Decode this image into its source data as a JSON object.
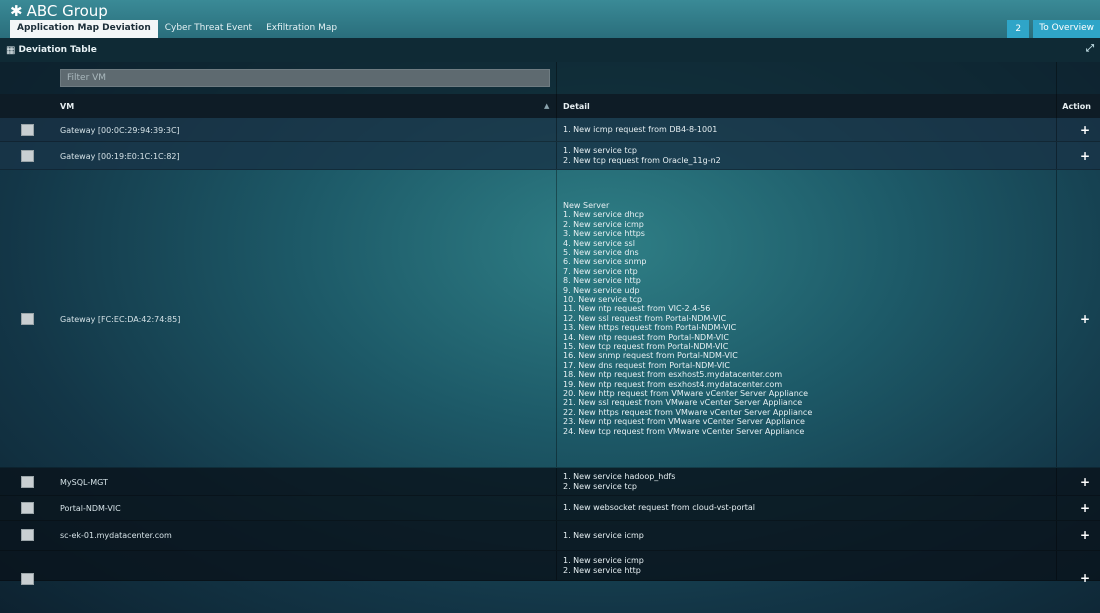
{
  "app": {
    "title": "ABC Group"
  },
  "tabs": [
    {
      "label": "Application Map Deviation",
      "active": true
    },
    {
      "label": "Cyber Threat Event",
      "active": false
    },
    {
      "label": "Exfiltration Map",
      "active": false
    }
  ],
  "controls": {
    "count": "2",
    "overview_label": "To Overview"
  },
  "section": {
    "title": "Deviation Table"
  },
  "filter": {
    "placeholder": "Filter VM"
  },
  "table": {
    "headers": {
      "vm": "VM",
      "detail": "Detail",
      "action": "Action"
    },
    "rows": [
      {
        "vm": "Gateway [00:0C:29:94:39:3C]",
        "detail": [
          "1. New icmp request from DB4-8-1001"
        ]
      },
      {
        "vm": "Gateway [00:19:E0:1C:1C:82]",
        "detail": [
          "1. New service tcp",
          "2. New tcp request from Oracle_11g-n2"
        ]
      },
      {
        "vm": "Gateway [FC:EC:DA:42:74:85]",
        "detail": [
          "New Server",
          "1. New service dhcp",
          "2. New service icmp",
          "3. New service https",
          "4. New service ssl",
          "5. New service dns",
          "6. New service snmp",
          "7. New service ntp",
          "8. New service http",
          "9. New service udp",
          "10. New service tcp",
          "11. New ntp request from VIC-2.4-56",
          "12. New ssl request from Portal-NDM-VIC",
          "13. New https request from Portal-NDM-VIC",
          "14. New ntp request from Portal-NDM-VIC",
          "15. New tcp request from Portal-NDM-VIC",
          "16. New snmp request from Portal-NDM-VIC",
          "17. New dns request from Portal-NDM-VIC",
          "18. New ntp request from esxhost5.mydatacenter.com",
          "19. New ntp request from esxhost4.mydatacenter.com",
          "20. New http request from VMware vCenter Server Appliance",
          "21. New ssl request from VMware vCenter Server Appliance",
          "22. New https request from VMware vCenter Server Appliance",
          "23. New ntp request from VMware vCenter Server Appliance",
          "24. New tcp request from VMware vCenter Server Appliance"
        ]
      },
      {
        "vm": "MySQL-MGT",
        "detail": [
          "1. New service hadoop_hdfs",
          "2. New service tcp"
        ]
      },
      {
        "vm": "Portal-NDM-VIC",
        "detail": [
          "1. New websocket request from cloud-vst-portal"
        ]
      },
      {
        "vm": "sc-ek-01.mydatacenter.com",
        "detail": [
          "1. New service icmp"
        ]
      },
      {
        "vm": "",
        "detail": [
          "1. New service icmp",
          "2. New service http"
        ]
      }
    ],
    "action_glyph": "+"
  }
}
